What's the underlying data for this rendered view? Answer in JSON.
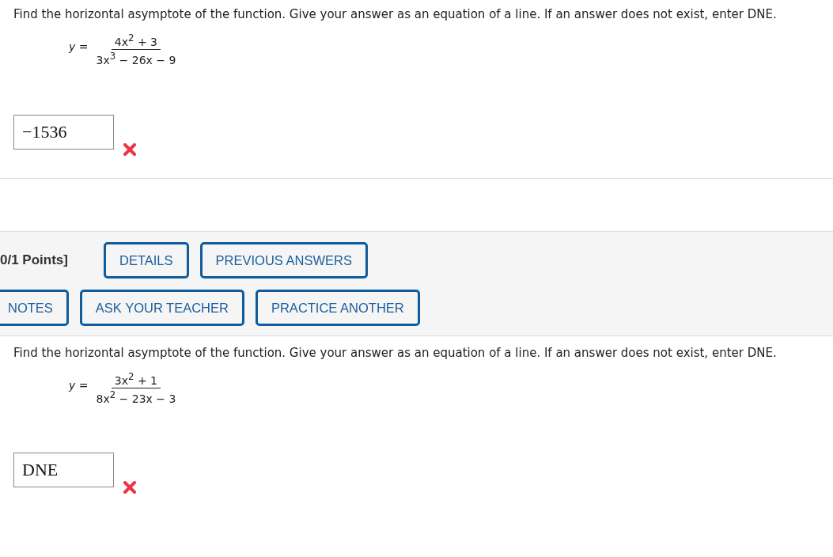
{
  "questions": [
    {
      "prompt": "Find the horizontal asymptote of the function. Give your answer as an equation of a line. If an answer does not exist, enter DNE.",
      "equation": {
        "lhs": "*y* =",
        "numerator": "4x$^{2}$ + 3",
        "denominator": "3x$^{3}$ − 26x − 9"
      },
      "answer": {
        "value": "−1536",
        "correct": false
      }
    },
    {
      "header": {
        "points": "0/1 Points]",
        "button_rows": [
          [
            "DETAILS",
            "PREVIOUS ANSWERS"
          ],
          [
            "NOTES",
            "ASK YOUR TEACHER",
            "PRACTICE ANOTHER"
          ]
        ]
      },
      "prompt": "Find the horizontal asymptote of the function. Give your answer as an equation of a line. If an answer does not exist, enter DNE.",
      "equation": {
        "lhs": "*y* =",
        "numerator": "3x$^{2}$ + 1",
        "denominator": "8x$^{2}$ − 23x − 3"
      },
      "answer": {
        "value": "DNE",
        "correct": false
      }
    }
  ]
}
